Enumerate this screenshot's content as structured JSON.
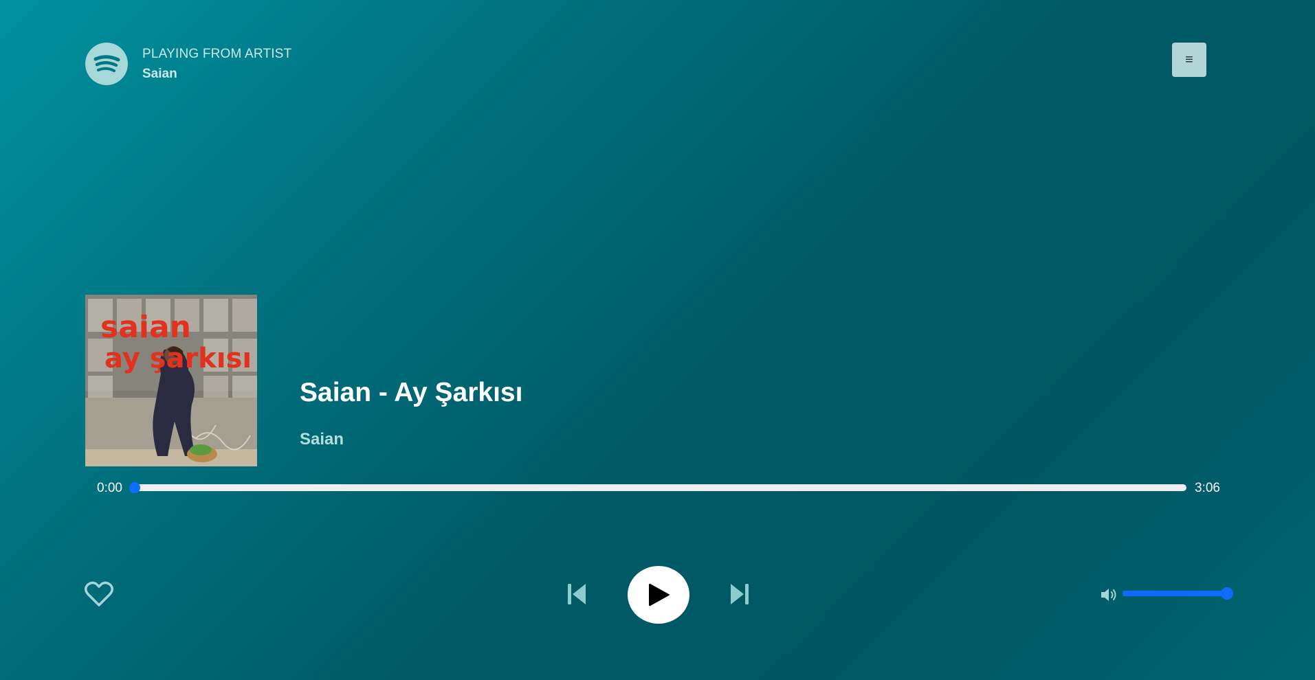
{
  "header": {
    "context_label": "PLAYING FROM ARTIST",
    "context_name": "Saian",
    "logo_icon": "spotify-logo-icon",
    "menu_label": "≡"
  },
  "track": {
    "title": "Saian - Ay Şarkısı",
    "artist": "Saian",
    "cover_text_line1": "saian",
    "cover_text_line2": "ay şarkısı"
  },
  "playback": {
    "current_time": "0:00",
    "duration": "3:06",
    "progress_fraction": 0,
    "volume_fraction": 1.0,
    "is_playing": false
  },
  "controls": {
    "like_icon": "heart-outline-icon",
    "prev_icon": "skip-back-icon",
    "play_icon": "play-icon",
    "next_icon": "skip-forward-icon",
    "volume_icon": "volume-icon"
  },
  "colors": {
    "accent": "#0d6efd",
    "background_start": "#00919f",
    "background_end": "#005763"
  }
}
